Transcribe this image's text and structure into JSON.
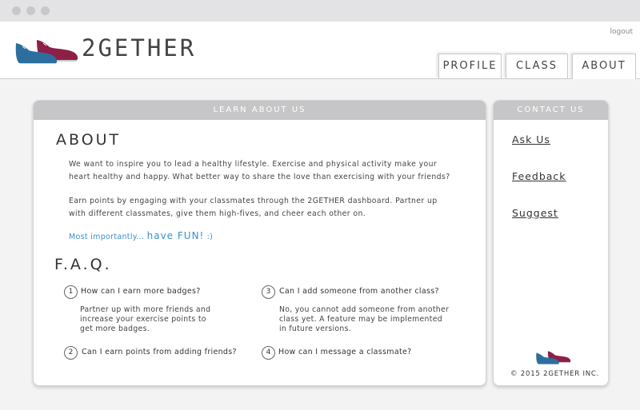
{
  "brand": {
    "name": "2GETHER"
  },
  "header": {
    "logout": "logout"
  },
  "nav": {
    "tabs": [
      {
        "label": "PROFILE"
      },
      {
        "label": "CLASS"
      },
      {
        "label": "ABOUT",
        "active": true
      }
    ]
  },
  "learn": {
    "heading": "LEARN ABOUT US",
    "about_title": "ABOUT",
    "about_line1": "We want to inspire you to lead a healthy lifestyle. Exercise and physical activity make your",
    "about_line2": "heart healthy and happy. What better way to share the love than exercising with your friends?",
    "points_line1": "Earn points by engaging with your classmates through the 2GETHER dashboard. Partner up",
    "points_line2": "with different classmates, give them high-fives, and cheer each other on.",
    "fun_prefix": "Most importantly... ",
    "fun_emph": "have FUN!",
    "fun_suffix": " :)",
    "faq_title": "F.A.Q.",
    "faq": [
      {
        "num": "1",
        "q": "How can I earn more badges?",
        "a_lines": [
          "Partner up with more friends and",
          "increase your exercise points to",
          "get more badges."
        ]
      },
      {
        "num": "2",
        "q": "Can I earn points from adding friends?",
        "a_lines": []
      },
      {
        "num": "3",
        "q": "Can I add someone from another class?",
        "a_lines": [
          "No, you cannot add someone from another",
          "class yet. A feature may be implemented",
          "in future versions."
        ]
      },
      {
        "num": "4",
        "q": "How can I message a classmate?",
        "a_lines": []
      }
    ]
  },
  "contact": {
    "heading": "CONTACT US",
    "links": [
      {
        "label": "Ask Us"
      },
      {
        "label": "Feedback"
      },
      {
        "label": "Suggest"
      }
    ],
    "copyright": "© 2015 2GETHER INC."
  },
  "colors": {
    "accent_blue": "#3a8fd0",
    "shoe_blue": "#2c6f9e",
    "shoe_maroon": "#8e1f47",
    "panel_header": "#c6c6c8"
  }
}
